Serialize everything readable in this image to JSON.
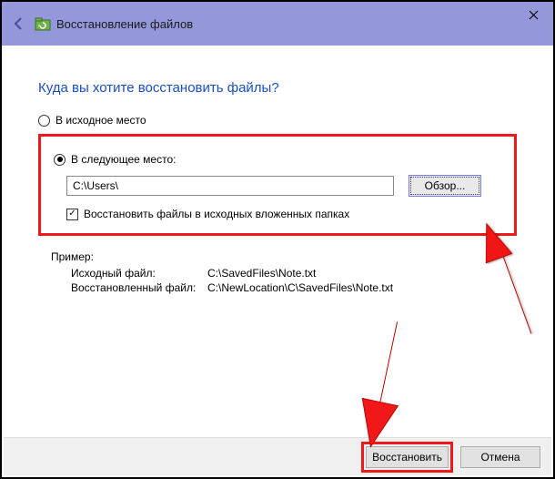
{
  "titlebar": {
    "title": "Восстановление файлов"
  },
  "heading": "Куда вы хотите восстановить файлы?",
  "radio": {
    "original": "В исходное место",
    "following": "В следующее место:"
  },
  "path_value": "C:\\Users\\",
  "browse_label": "Обзор...",
  "checkbox_label": "Восстановить файлы в исходных вложенных папках",
  "example": {
    "title": "Пример:",
    "row1_label": "Исходный файл:",
    "row1_value": "C:\\SavedFiles\\Note.txt",
    "row2_label": "Восстановленный файл:",
    "row2_value": "C:\\NewLocation\\C\\SavedFiles\\Note.txt"
  },
  "footer": {
    "restore": "Восстановить",
    "cancel": "Отмена"
  }
}
